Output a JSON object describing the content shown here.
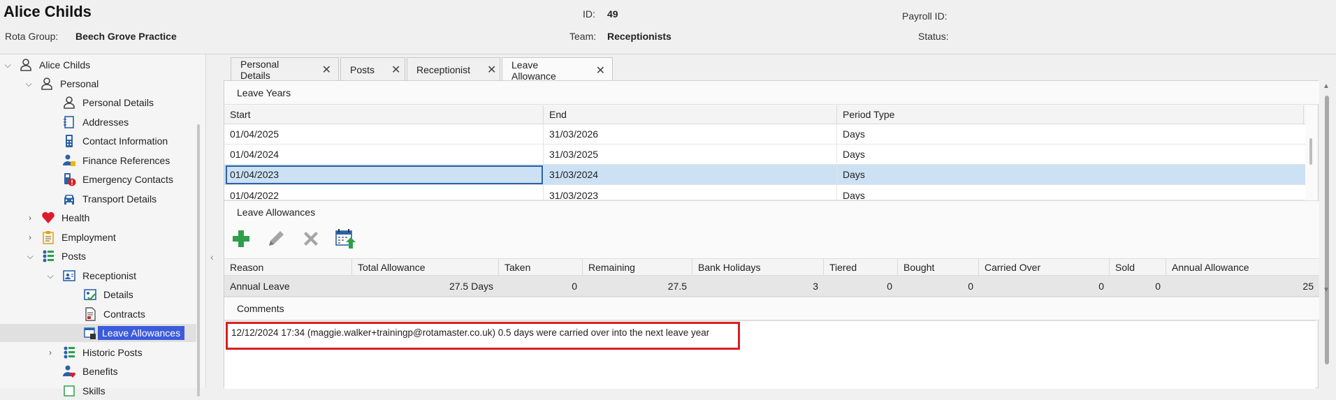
{
  "header": {
    "employee_name": "Alice Childs",
    "id_label": "ID:",
    "id_value": "49",
    "payroll_label": "Payroll ID:",
    "payroll_value": "",
    "rota_group_label": "Rota Group:",
    "rota_group_value": "Beech Grove Practice",
    "team_label": "Team:",
    "team_value": "Receptionists",
    "status_label": "Status:",
    "status_value": ""
  },
  "tree": {
    "root": "Alice Childs",
    "personal": "Personal",
    "personal_details": "Personal Details",
    "addresses": "Addresses",
    "contact_information": "Contact Information",
    "finance_references": "Finance References",
    "emergency_contacts": "Emergency Contacts",
    "transport_details": "Transport Details",
    "health": "Health",
    "employment": "Employment",
    "posts": "Posts",
    "receptionist": "Receptionist",
    "details": "Details",
    "contracts": "Contracts",
    "leave_allowances": "Leave Allowances",
    "historic_posts": "Historic Posts",
    "benefits": "Benefits",
    "skills": "Skills"
  },
  "tabs": [
    {
      "label": "Personal Details",
      "close": "✕"
    },
    {
      "label": "Posts",
      "close": "✕"
    },
    {
      "label": "Receptionist",
      "close": "✕"
    },
    {
      "label": "Leave Allowance",
      "close": "✕"
    }
  ],
  "leave_years": {
    "title": "Leave Years",
    "columns": [
      "Start",
      "End",
      "Period Type"
    ],
    "rows": [
      [
        "01/04/2025",
        "31/03/2026",
        "Days"
      ],
      [
        "01/04/2024",
        "31/03/2025",
        "Days"
      ],
      [
        "01/04/2023",
        "31/03/2024",
        "Days"
      ],
      [
        "01/04/2022",
        "31/03/2023",
        "Days"
      ]
    ]
  },
  "leave_allowances": {
    "title": "Leave Allowances",
    "columns": [
      "Reason",
      "Total Allowance",
      "Taken",
      "Remaining",
      "Bank Holidays",
      "Tiered",
      "Bought",
      "Carried Over",
      "Sold",
      "Annual Allowance"
    ],
    "row": [
      "Annual Leave",
      "27.5 Days",
      "0",
      "27.5",
      "3",
      "0",
      "0",
      "0",
      "0",
      "25"
    ]
  },
  "comments": {
    "title": "Comments",
    "text": "12/12/2024 17:34 (maggie.walker+trainingp@rotamaster.co.uk) 0.5 days were carried over into the next leave year"
  },
  "colors": {
    "accent_selected": "#3b5bdb",
    "row_selected": "#cce1f4",
    "highlight_box": "#d81f26",
    "add_green": "#2e9e4a"
  }
}
